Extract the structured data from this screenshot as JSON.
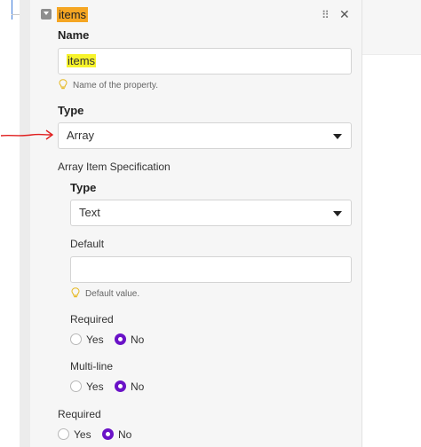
{
  "header": {
    "title": "items"
  },
  "name_field": {
    "label": "Name",
    "value": "items",
    "hint": "Name of the property."
  },
  "type_field": {
    "label": "Type",
    "selected": "Array"
  },
  "array_spec": {
    "label": "Array Item Specification",
    "type_label": "Type",
    "type_selected": "Text",
    "default_label": "Default",
    "default_value": "",
    "default_hint": "Default value.",
    "required_label": "Required",
    "required_options": [
      "Yes",
      "No"
    ],
    "required_selected": "No",
    "multiline_label": "Multi-line",
    "multiline_options": [
      "Yes",
      "No"
    ],
    "multiline_selected": "No"
  },
  "required": {
    "label": "Required",
    "options": [
      "Yes",
      "No"
    ],
    "selected": "No"
  },
  "colors": {
    "title_highlight": "#f5a623",
    "value_highlight": "#f7f32b",
    "radio_selected": "#6a12c7",
    "annotation_arrow": "#e02020"
  }
}
